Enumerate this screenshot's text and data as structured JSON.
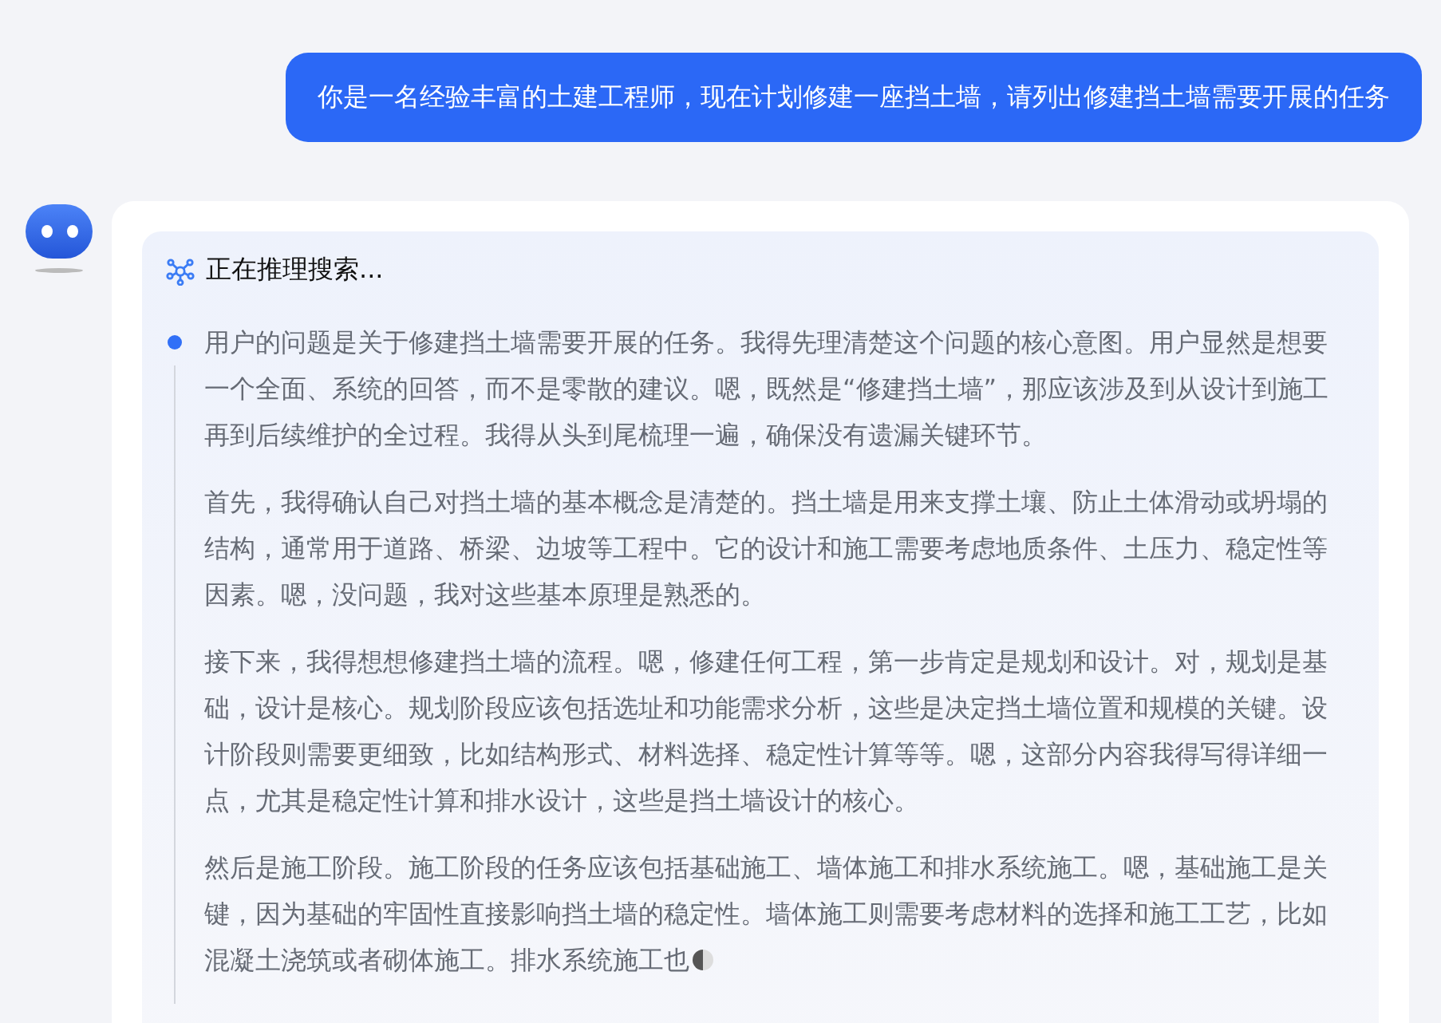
{
  "user_message": "你是一名经验丰富的土建工程师，现在计划修建一座挡土墙，请列出修建挡土墙需要开展的任务",
  "assistant": {
    "status": "正在推理搜索...",
    "paragraphs": [
      "用户的问题是关于修建挡土墙需要开展的任务。我得先理清楚这个问题的核心意图。用户显然是想要一个全面、系统的回答，而不是零散的建议。嗯，既然是“修建挡土墙”，那应该涉及到从设计到施工再到后续维护的全过程。我得从头到尾梳理一遍，确保没有遗漏关键环节。",
      "首先，我得确认自己对挡土墙的基本概念是清楚的。挡土墙是用来支撑土壤、防止土体滑动或坍塌的结构，通常用于道路、桥梁、边坡等工程中。它的设计和施工需要考虑地质条件、土压力、稳定性等因素。嗯，没问题，我对这些基本原理是熟悉的。",
      "接下来，我得想想修建挡土墙的流程。嗯，修建任何工程，第一步肯定是规划和设计。对，规划是基础，设计是核心。规划阶段应该包括选址和功能需求分析，这些是决定挡土墙位置和规模的关键。设计阶段则需要更细致，比如结构形式、材料选择、稳定性计算等等。嗯，这部分内容我得写得详细一点，尤其是稳定性计算和排水设计，这些是挡土墙设计的核心。",
      "然后是施工阶段。施工阶段的任务应该包括基础施工、墙体施工和排水系统施工。嗯，基础施工是关键，因为基础的牢固性直接影响挡土墙的稳定性。墙体施工则需要考虑材料的选择和施工工艺，比如混凝土浇筑或者砌体施工。排水系统施工也"
    ]
  }
}
